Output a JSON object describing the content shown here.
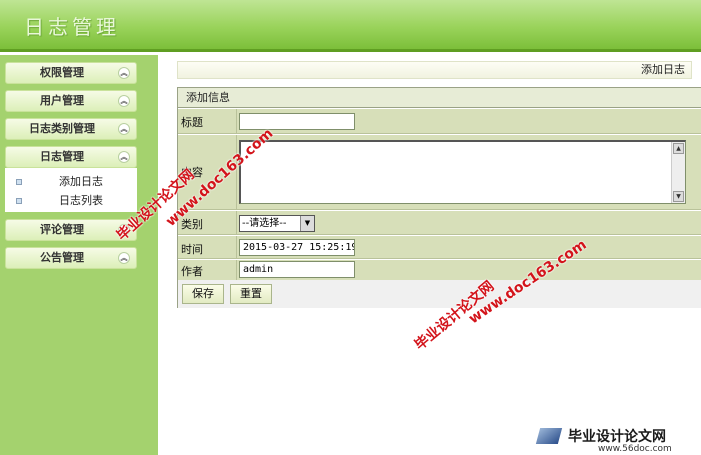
{
  "header": {
    "title": "日志管理"
  },
  "sidebar": {
    "menus": [
      {
        "label": "权限管理"
      },
      {
        "label": "用户管理"
      },
      {
        "label": "日志类别管理"
      },
      {
        "label": "日志管理"
      },
      {
        "label": "评论管理"
      },
      {
        "label": "公告管理"
      }
    ],
    "submenu": [
      {
        "label": "添加日志"
      },
      {
        "label": "日志列表"
      }
    ]
  },
  "breadcrumb": "添加日志",
  "form": {
    "header": "添加信息",
    "title_label": "标题",
    "title_value": "",
    "content_label": "内容",
    "category_label": "类别",
    "category_selected": "--请选择--",
    "time_label": "时间",
    "time_value": "2015-03-27 15:25:19",
    "author_label": "作者",
    "author_value": "admin",
    "save_label": "保存",
    "reset_label": "重置"
  },
  "watermarks": {
    "text_cn": "毕业设计论文网",
    "text_url": "www.doc163.com",
    "logo_cn": "毕业设计论文网",
    "logo_url": "www.56doc.com"
  },
  "colors": {
    "header_green": "#9ad35b",
    "sidebar_green": "#a4d26e",
    "form_row": "#d7dfb9",
    "watermark_red": "#d3141b"
  }
}
